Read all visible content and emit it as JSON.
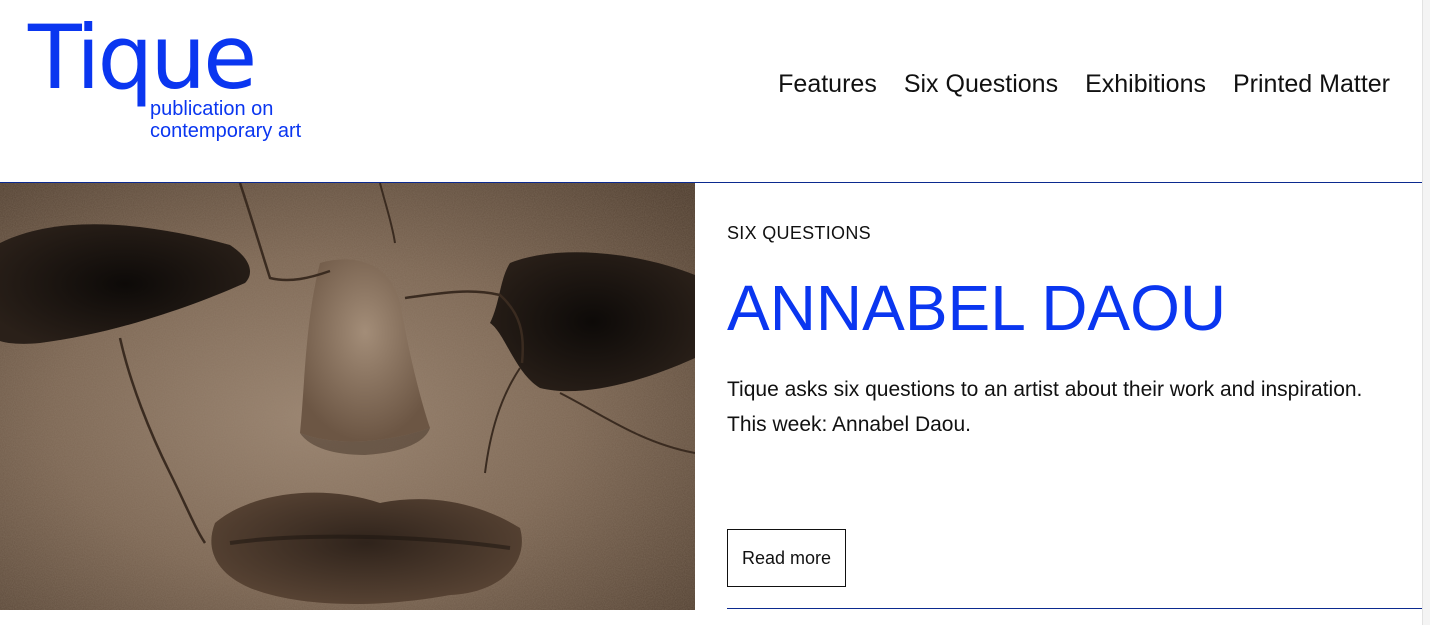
{
  "brand": {
    "name": "Tique",
    "tagline_line1": "publication on",
    "tagline_line2": "contemporary art",
    "accent_color": "#0a36f0"
  },
  "nav": {
    "items": [
      {
        "label": "Features"
      },
      {
        "label": "Six Questions"
      },
      {
        "label": "Exhibitions"
      },
      {
        "label": "Printed Matter"
      }
    ]
  },
  "feature": {
    "category": "SIX QUESTIONS",
    "title": "ANNABEL DAOU",
    "summary_line1": "Tique asks six questions to an artist about their work and inspiration.",
    "summary_line2": "This week: Annabel Daou.",
    "read_more_label": "Read more",
    "image_icon": "cracked-stone-mask-photo"
  }
}
